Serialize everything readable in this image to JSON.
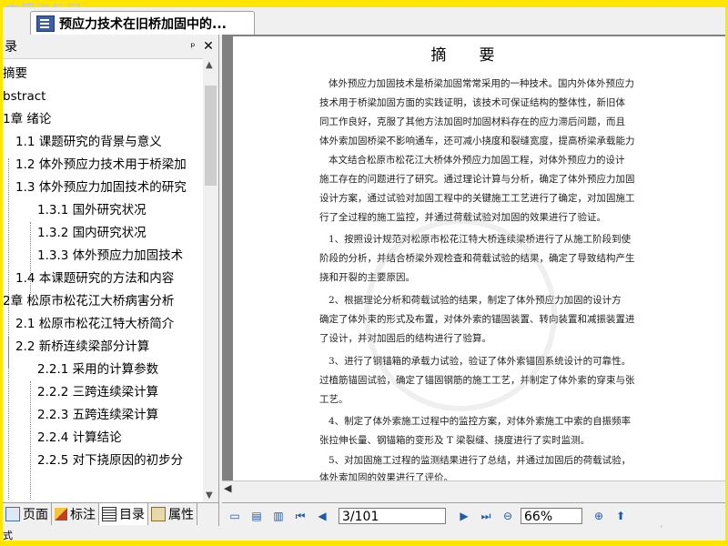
{
  "watermarks": {
    "top": "中国港标网",
    "bottom": "www.cndao.com"
  },
  "tab": {
    "title": "预应力技术在旧桥加固中的...",
    "icon": "document-icon"
  },
  "toc_panel": {
    "title": "录",
    "pin": "ᵖ",
    "close": "✕",
    "items": [
      "摘要",
      "bstract",
      "1章 绪论",
      "1.1 课题研究的背景与意义",
      "1.2 体外预应力技术用于桥梁加",
      "1.3 体外预应力加固技术的研究",
      "1.3.1 国外研究状况",
      "1.3.2 国内研究状况",
      "1.3.3 体外预应力加固技术",
      "1.4 本课题研究的方法和内容",
      "2章 松原市松花江大桥病害分析",
      "2.1 松原市松花江特大桥简介",
      "2.2 新桥连续梁部分计算",
      "2.2.1 采用的计算参数",
      "2.2.2 三跨连续梁计算",
      "2.2.3 五跨连续梁计算",
      "2.2.4 计算结论",
      "2.2.5 对下挠原因的初步分"
    ]
  },
  "panel_tabs": [
    "页面",
    "标注",
    "目录",
    "属性"
  ],
  "page": {
    "heading": "摘要",
    "paragraphs": [
      "体外预应力加固技术是桥梁加固常常采用的一种技术。国内外体外预应力",
      "技术用于桥梁加固方面的实践证明，该技术可保证结构的整体性，新旧体",
      "同工作良好，克服了其他方法加固时加固材料存在的应力滞后问题，而且",
      "体外索加固桥梁不影响通车，还可减小挠度和裂缝宽度，提高桥梁承载能力",
      "本文结合松原市松花江大桥体外预应力加固工程，对体外预应力的设计",
      "施工存在的问题进行了研究。通过理论计算与分析，确定了体外预应力加固",
      "设计方案，通过试验对加固工程中的关键施工工艺进行了确定，对加固施工",
      "行了全过程的施工监控，并通过荷载试验对加固的效果进行了验证。",
      "1、按照设计规范对松原市松花江特大桥连续梁桥进行了从施工阶段到使",
      "阶段的分析，并结合桥梁外观检查和荷载试验的结果，确定了导致结构产生",
      "挠和开裂的主要原因。",
      "2、根据理论分析和荷载试验的结果，制定了体外预应力加固的设计方",
      "确定了体外束的形式及布置，对体外索的锚固装置、转向装置和减振装置进",
      "了设计，并对加固后的结构进行了验算。",
      "3、进行了钢锚箱的承载力试验，验证了体外索锚固系统设计的可靠性。",
      "过植筋锚固试验，确定了锚固钢筋的施工工艺，并制定了体外索的穿束与张",
      "工艺。",
      "4、制定了体外索施工过程中的监控方案，对体外索施工中索的自振频率",
      "张拉伸长量、钢锚箱的变形及 T 梁裂缝、挠度进行了实时监测。",
      "5、对加固施工过程的监测结果进行了总结，并通过加固后的荷载试验，",
      "体外索加固的效果进行了评价。"
    ]
  },
  "toolbar": {
    "page_value": "3/101",
    "zoom_value": "66%"
  },
  "bottom_strip": {
    "text": "式"
  }
}
